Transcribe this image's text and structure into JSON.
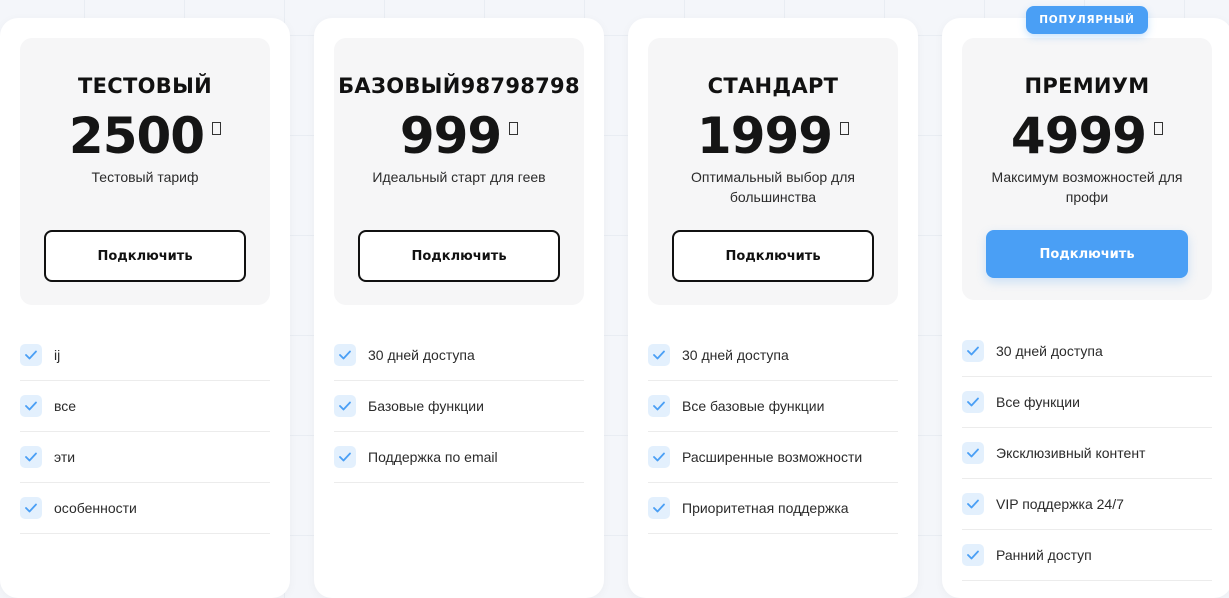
{
  "badge": "ПОПУЛЯРНЫЙ",
  "accent_color": "#4a9ff5",
  "check_icon": "check-icon",
  "currency_icon": "currency-placeholder-icon",
  "plans": [
    {
      "title": "ТЕСТОВЫЙ",
      "price": "2500",
      "description": "Тестовый тариф",
      "button": "Подключить",
      "features": [
        "ij",
        "все",
        "эти",
        "особенности"
      ]
    },
    {
      "title": "БАЗОВЫЙ98798798",
      "price": "999",
      "description": "Идеальный старт для геев",
      "button": "Подключить",
      "features": [
        "30 дней доступа",
        "Базовые функции",
        "Поддержка по email"
      ]
    },
    {
      "title": "СТАНДАРТ",
      "price": "1999",
      "description": "Оптимальный выбор для большинства",
      "button": "Подключить",
      "features": [
        "30 дней доступа",
        "Все базовые функции",
        "Расширенные возможности",
        "Приоритетная поддержка"
      ]
    },
    {
      "title": "ПРЕМИУМ",
      "price": "4999",
      "description": "Максимум возможностей для профи",
      "button": "Подключить",
      "features": [
        "30 дней доступа",
        "Все функции",
        "Эксклюзивный контент",
        "VIP поддержка 24/7",
        "Ранний доступ"
      ]
    }
  ]
}
